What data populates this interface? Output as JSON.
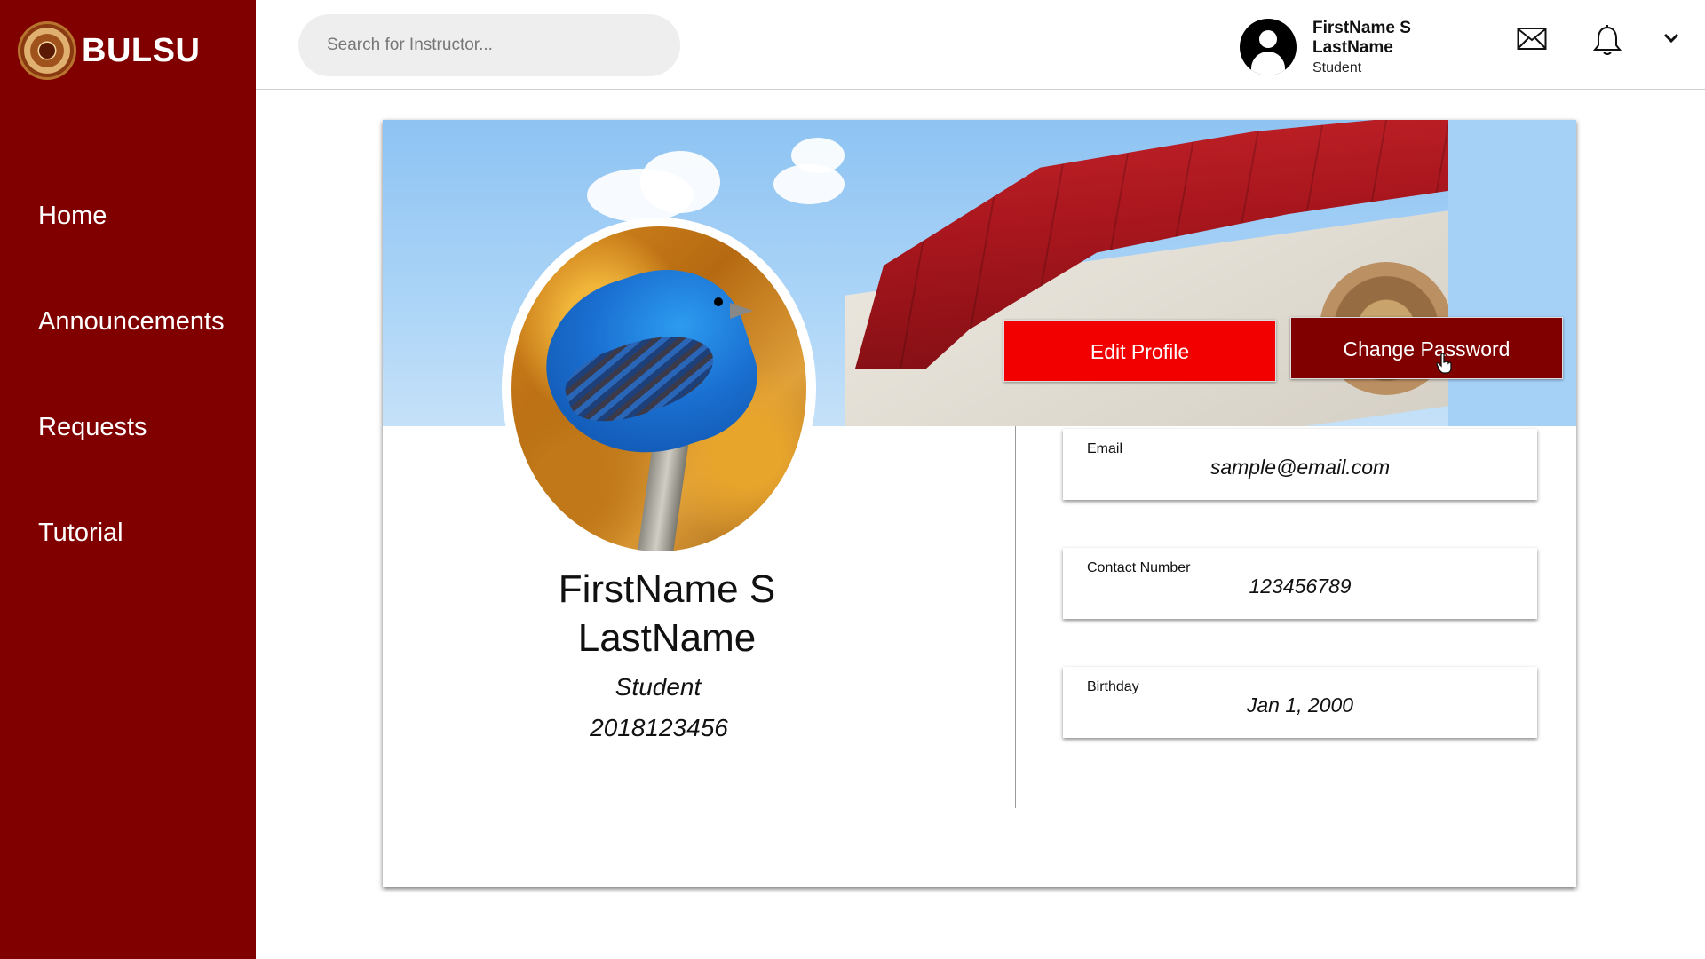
{
  "brand": {
    "name": "BULSU"
  },
  "nav": [
    {
      "label": "Home"
    },
    {
      "label": "Announcements"
    },
    {
      "label": "Requests"
    },
    {
      "label": "Tutorial"
    }
  ],
  "search": {
    "placeholder": "Search for Instructor..."
  },
  "user": {
    "name": "FirstName S LastName",
    "role": "Student"
  },
  "header_icons": [
    "mail-icon",
    "bell-icon",
    "chevron-down-icon"
  ],
  "profile": {
    "full_name": "FirstName S LastName",
    "role": "Student",
    "id_number": "2018123456",
    "edit_button": "Edit Profile",
    "change_password_button": "Change Password"
  },
  "fields": {
    "email": {
      "label": "Email",
      "value": "sample@email.com"
    },
    "contact": {
      "label": "Contact Number",
      "value": "123456789"
    },
    "birthday": {
      "label": "Birthday",
      "value": "Jan 1, 2000"
    }
  },
  "colors": {
    "sidebar": "#800000",
    "edit_button": "#f20000",
    "change_password_button": "#800000"
  }
}
